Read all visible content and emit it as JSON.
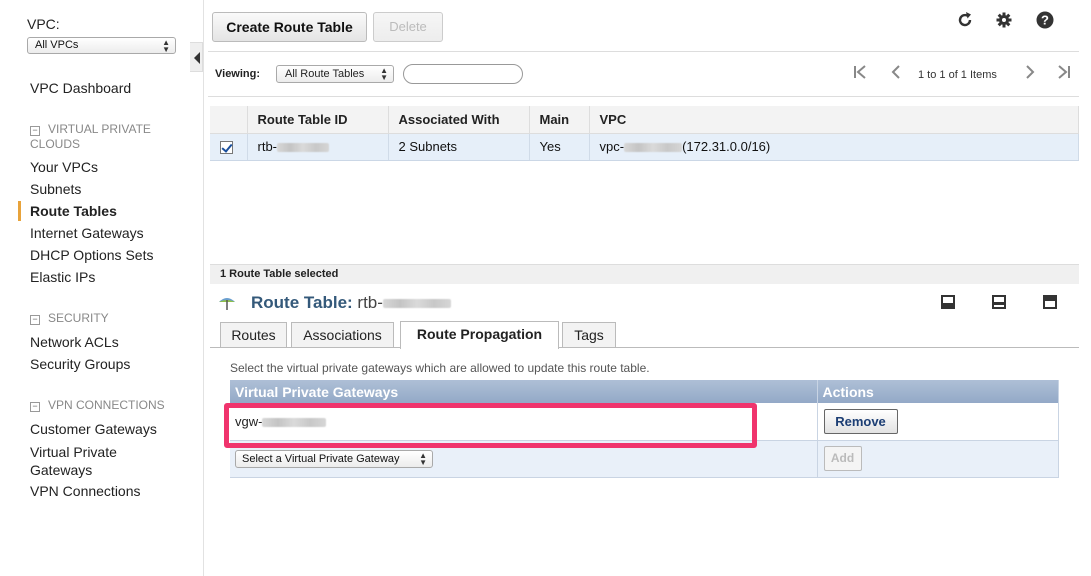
{
  "sidebar": {
    "vpc_label": "VPC:",
    "vpc_select": "All VPCs",
    "dashboard": "VPC Dashboard",
    "section_vpc": "VIRTUAL PRIVATE CLOUDS",
    "your_vpcs": "Your VPCs",
    "subnets": "Subnets",
    "route_tables": "Route Tables",
    "internet_gateways": "Internet Gateways",
    "dhcp_options": "DHCP Options Sets",
    "elastic_ips": "Elastic IPs",
    "section_security": "SECURITY",
    "network_acls": "Network ACLs",
    "security_groups": "Security Groups",
    "section_vpn": "VPN CONNECTIONS",
    "customer_gateways": "Customer Gateways",
    "virtual_private_gateways": "Virtual Private Gateways",
    "vpn_connections": "VPN Connections"
  },
  "toolbar": {
    "create_label": "Create Route Table",
    "delete_label": "Delete",
    "viewing_label": "Viewing:",
    "viewing_select": "All Route Tables",
    "search_value": "",
    "pager_text": "1 to 1 of 1 Items"
  },
  "table": {
    "headers": [
      "Route Table ID",
      "Associated With",
      "Main",
      "VPC"
    ],
    "rows": [
      {
        "id": "rtb-",
        "associated": "2 Subnets",
        "main": "Yes",
        "vpc_prefix": "vpc-",
        "vpc_cidr": "(172.31.0.0/16)"
      }
    ]
  },
  "detail": {
    "selected_text": "1 Route Table selected",
    "title_label": "Route Table:",
    "title_value": "rtb-",
    "tabs": [
      "Routes",
      "Associations",
      "Route Propagation",
      "Tags"
    ],
    "active_tab": "Route Propagation",
    "description": "Select the virtual private gateways which are allowed to update this route table.",
    "vgw_header": "Virtual Private Gateways",
    "actions_header": "Actions",
    "vgw_value": "vgw-",
    "remove_label": "Remove",
    "add_select": "Select a Virtual Private Gateway",
    "add_label": "Add"
  },
  "colors": {
    "accent_bar": "#e8a33b",
    "highlight": "#f0346d",
    "title": "#34597a"
  }
}
